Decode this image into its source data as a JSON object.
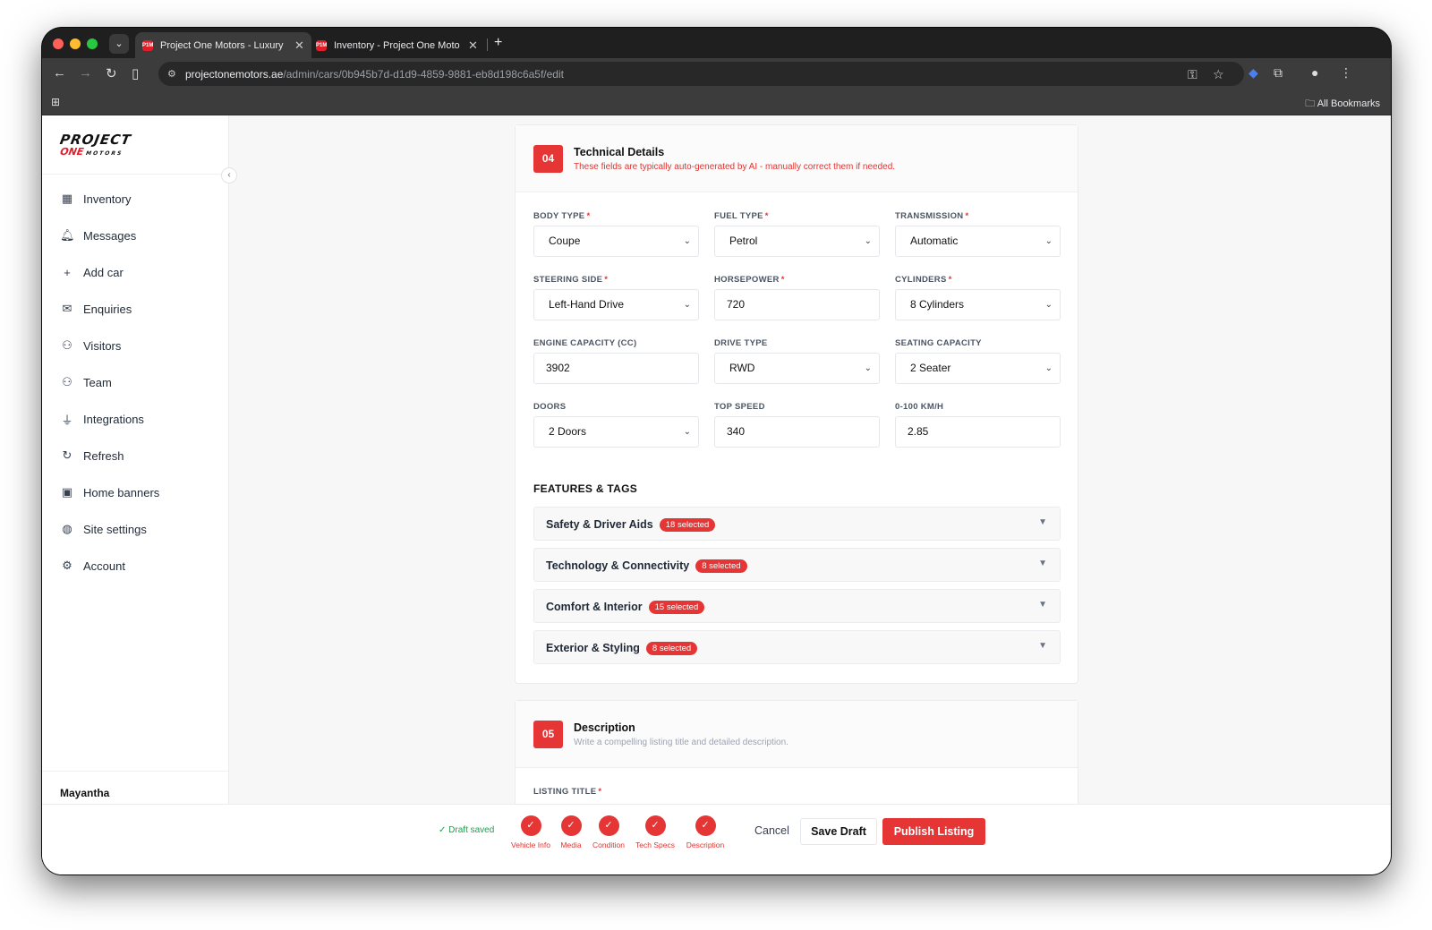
{
  "browser": {
    "tabs": [
      {
        "label": "Project One Motors - Luxury",
        "favicon": "P1M"
      },
      {
        "label": "Inventory - Project One Moto",
        "favicon": "P1M"
      }
    ],
    "url_host": "projectonemotors.ae",
    "url_path": "/admin/cars/0b945b7d-d1d9-4859-9881-eb8d198c6a5f/edit",
    "bookmarks_label": "All Bookmarks"
  },
  "sidebar": {
    "logo_top": "PROJECT",
    "logo_bottom": "ONE",
    "logo_sub": "MOTORS",
    "items": [
      {
        "label": "Inventory",
        "icon": "grid-icon"
      },
      {
        "label": "Messages",
        "icon": "bell-icon"
      },
      {
        "label": "Add car",
        "icon": "plus-icon"
      },
      {
        "label": "Enquiries",
        "icon": "mail-icon"
      },
      {
        "label": "Visitors",
        "icon": "user-icon"
      },
      {
        "label": "Team",
        "icon": "user-icon"
      },
      {
        "label": "Integrations",
        "icon": "plug-icon"
      },
      {
        "label": "Refresh",
        "icon": "refresh-icon"
      },
      {
        "label": "Home banners",
        "icon": "image-icon"
      },
      {
        "label": "Site settings",
        "icon": "globe-icon"
      },
      {
        "label": "Account",
        "icon": "gear-icon"
      }
    ],
    "user_name": "Mayantha"
  },
  "technical": {
    "number": "04",
    "title": "Technical Details",
    "subtitle": "These fields are typically auto-generated by AI - manually correct them if needed.",
    "fields": [
      {
        "label": "BODY TYPE",
        "required": true,
        "value": "Coupe",
        "type": "select"
      },
      {
        "label": "FUEL TYPE",
        "required": true,
        "value": "Petrol",
        "type": "select"
      },
      {
        "label": "TRANSMISSION",
        "required": true,
        "value": "Automatic",
        "type": "select"
      },
      {
        "label": "STEERING SIDE",
        "required": true,
        "value": "Left-Hand Drive",
        "type": "select"
      },
      {
        "label": "HORSEPOWER",
        "required": true,
        "value": "720",
        "type": "input"
      },
      {
        "label": "CYLINDERS",
        "required": true,
        "value": "8 Cylinders",
        "type": "select"
      },
      {
        "label": "ENGINE CAPACITY (CC)",
        "required": false,
        "value": "3902",
        "type": "input"
      },
      {
        "label": "DRIVE TYPE",
        "required": false,
        "value": "RWD",
        "type": "select"
      },
      {
        "label": "SEATING CAPACITY",
        "required": false,
        "value": "2 Seater",
        "type": "select"
      },
      {
        "label": "DOORS",
        "required": false,
        "value": "2 Doors",
        "type": "select"
      },
      {
        "label": "TOP SPEED",
        "required": false,
        "value": "340",
        "type": "input"
      },
      {
        "label": "0-100 KM/H",
        "required": false,
        "value": "2.85",
        "type": "input"
      }
    ],
    "features_title": "FEATURES & TAGS",
    "features": [
      {
        "label": "Safety & Driver Aids",
        "count": "18 selected"
      },
      {
        "label": "Technology & Connectivity",
        "count": "8 selected"
      },
      {
        "label": "Comfort & Interior",
        "count": "15 selected"
      },
      {
        "label": "Exterior & Styling",
        "count": "8 selected"
      }
    ]
  },
  "description": {
    "number": "05",
    "title": "Description",
    "subtitle": "Write a compelling listing title and detailed description.",
    "listing_title_label": "LISTING TITLE"
  },
  "actions": {
    "draft_status": "Draft saved",
    "steps": [
      "Vehicle Info",
      "Media",
      "Condition",
      "Tech Specs",
      "Description"
    ],
    "cancel": "Cancel",
    "save_draft": "Save Draft",
    "publish": "Publish Listing"
  },
  "colors": {
    "accent": "#e53535",
    "success": "#16a34a"
  }
}
